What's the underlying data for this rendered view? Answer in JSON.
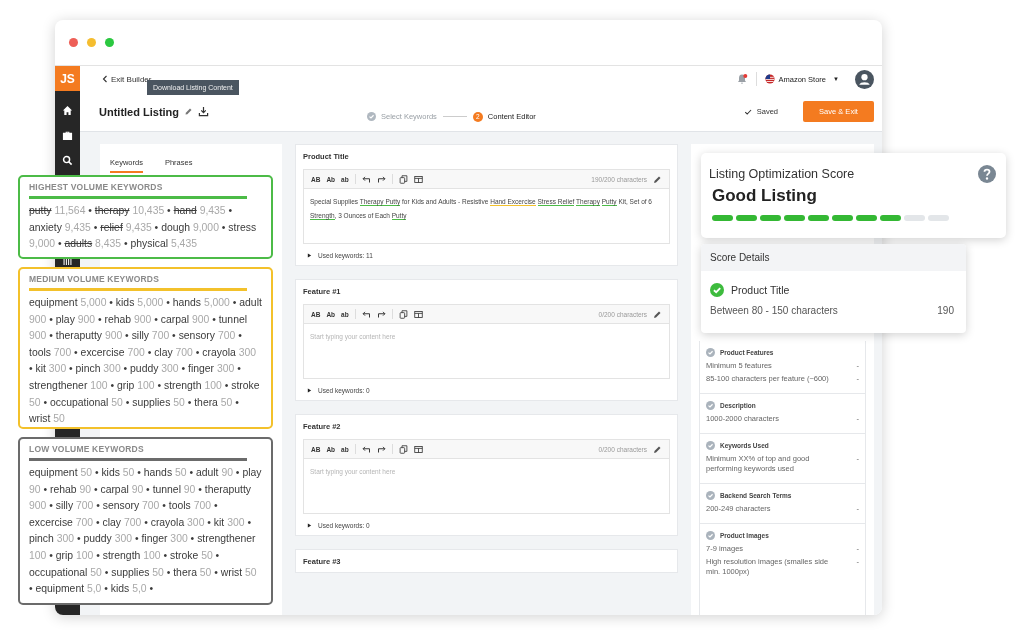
{
  "window": {
    "controls": [
      {
        "color": "#ee5f57"
      },
      {
        "color": "#f5bd2f"
      },
      {
        "color": "#2bc840"
      }
    ]
  },
  "sidebar": {
    "logo": "JS"
  },
  "header": {
    "back_link": "Exit Builder",
    "tooltip": "Download Listing Content",
    "title": "Untitled Listing",
    "steps": [
      {
        "label": "Select Keywords",
        "kind": "done",
        "selected": false
      },
      {
        "label": "Content Editor",
        "number": "2",
        "kind": "current",
        "selected": true
      }
    ],
    "save_status": "Saved",
    "save_button": "Save & Exit",
    "store": "Amazon Store",
    "store_caret": "▼"
  },
  "keyword_tabs": [
    {
      "label": "Keywords",
      "selected": true
    },
    {
      "label": "Phrases",
      "selected": false
    }
  ],
  "separator": "•",
  "keyword_groups": [
    {
      "title": "HIGHEST VOLUME KEYWORDS",
      "color": "#4cbb47",
      "trailing_separator": false,
      "keywords": [
        {
          "word": "putty",
          "count": "11,564",
          "struck": true
        },
        {
          "word": "therapy",
          "count": "10,435",
          "struck": true
        },
        {
          "word": "hand",
          "count": "9,435",
          "struck": true
        },
        {
          "word": "anxiety",
          "count": "9,435",
          "struck": false
        },
        {
          "word": "relief",
          "count": "9,435",
          "struck": true
        },
        {
          "word": "dough",
          "count": "9,000",
          "struck": false
        },
        {
          "word": "stress",
          "count": "9,000",
          "struck": false
        },
        {
          "word": "adults",
          "count": "8,435",
          "struck": true
        },
        {
          "word": "physical",
          "count": "5,435",
          "struck": false
        }
      ]
    },
    {
      "title": "MEDIUM VOLUME KEYWORDS",
      "color": "#f3c12b",
      "trailing_separator": false,
      "keywords": [
        {
          "word": "equipment",
          "count": "5,000",
          "struck": false
        },
        {
          "word": "kids",
          "count": "5,000",
          "struck": false
        },
        {
          "word": "hands",
          "count": "5,000",
          "struck": false
        },
        {
          "word": "adult",
          "count": "900",
          "struck": false
        },
        {
          "word": "play",
          "count": "900",
          "struck": false
        },
        {
          "word": "rehab",
          "count": "900",
          "struck": false
        },
        {
          "word": "carpal",
          "count": "900",
          "struck": false
        },
        {
          "word": "tunnel",
          "count": "900",
          "struck": false
        },
        {
          "word": "theraputty",
          "count": "900",
          "struck": false
        },
        {
          "word": "silly",
          "count": "700",
          "struck": false
        },
        {
          "word": "sensory",
          "count": "700",
          "struck": false
        },
        {
          "word": "tools",
          "count": "700",
          "struck": false
        },
        {
          "word": "excercise",
          "count": "700",
          "struck": false
        },
        {
          "word": "clay",
          "count": "700",
          "struck": false
        },
        {
          "word": "crayola",
          "count": "300",
          "struck": false
        },
        {
          "word": "kit",
          "count": "300",
          "struck": false
        },
        {
          "word": "pinch",
          "count": "300",
          "struck": false
        },
        {
          "word": "puddy",
          "count": "300",
          "struck": false
        },
        {
          "word": "finger",
          "count": "300",
          "struck": false
        },
        {
          "word": "strengthener",
          "count": "100",
          "struck": false
        },
        {
          "word": "grip",
          "count": "100",
          "struck": false
        },
        {
          "word": "strength",
          "count": "100",
          "struck": false
        },
        {
          "word": "stroke",
          "count": "50",
          "struck": false
        },
        {
          "word": "occupational",
          "count": "50",
          "struck": false
        },
        {
          "word": "supplies",
          "count": "50",
          "struck": false
        },
        {
          "word": "thera",
          "count": "50",
          "struck": false
        },
        {
          "word": "wrist",
          "count": "50",
          "struck": false
        }
      ]
    },
    {
      "title": "LOW VOLUME KEYWORDS",
      "color": "#6b6b6b",
      "trailing_separator": true,
      "keywords": [
        {
          "word": "equipment",
          "count": "50",
          "struck": false
        },
        {
          "word": "kids",
          "count": "50",
          "struck": false
        },
        {
          "word": "hands",
          "count": "50",
          "struck": false
        },
        {
          "word": "adult",
          "count": "90",
          "struck": false
        },
        {
          "word": "play",
          "count": "90",
          "struck": false
        },
        {
          "word": "rehab",
          "count": "90",
          "struck": false
        },
        {
          "word": "carpal",
          "count": "90",
          "struck": false
        },
        {
          "word": "tunnel",
          "count": "90",
          "struck": false
        },
        {
          "word": "theraputty",
          "count": "900",
          "struck": false
        },
        {
          "word": "silly",
          "count": "700",
          "struck": false
        },
        {
          "word": "sensory",
          "count": "700",
          "struck": false
        },
        {
          "word": "tools",
          "count": "700",
          "struck": false
        },
        {
          "word": "excercise",
          "count": "700",
          "struck": false
        },
        {
          "word": "clay",
          "count": "700",
          "struck": false
        },
        {
          "word": "crayola",
          "count": "300",
          "struck": false
        },
        {
          "word": "kit",
          "count": "300",
          "struck": false
        },
        {
          "word": "pinch",
          "count": "300",
          "struck": false
        },
        {
          "word": "puddy",
          "count": "300",
          "struck": false
        },
        {
          "word": "finger",
          "count": "300",
          "struck": false
        },
        {
          "word": "strengthener",
          "count": "100",
          "struck": false
        },
        {
          "word": "grip",
          "count": "100",
          "struck": false
        },
        {
          "word": "strength",
          "count": "100",
          "struck": false
        },
        {
          "word": "stroke",
          "count": "50",
          "struck": false
        },
        {
          "word": "occupational",
          "count": "50",
          "struck": false
        },
        {
          "word": "supplies",
          "count": "50",
          "struck": false
        },
        {
          "word": "thera",
          "count": "50",
          "struck": false
        },
        {
          "word": "wrist",
          "count": "50",
          "struck": false
        },
        {
          "word": "equipment",
          "count": "5,0",
          "struck": false
        },
        {
          "word": "kids",
          "count": "5,0",
          "struck": false
        }
      ]
    }
  ],
  "editors": [
    {
      "label": "Product Title",
      "tools": [
        "AB",
        "Ab",
        "ab"
      ],
      "count": "190/200 characters",
      "used_keywords": "Used keywords: 11",
      "segments": [
        {
          "text": "Special Supplies "
        },
        {
          "text": "Therapy Putty",
          "color": "#4cbb47"
        },
        {
          "text": " for Kids and Adults - Resistive "
        },
        {
          "text": "Hand Excercise ",
          "color": "#f3c12b"
        },
        {
          "text": "Stress Relief ",
          "color": "#4cbb47"
        },
        {
          "text": "Therapy ",
          "color": "#4cbb47"
        },
        {
          "text": "Putty",
          "color": "#4cbb47"
        },
        {
          "text": " Kit, Set of 6 "
        },
        {
          "text": "Strength",
          "color": "#4cbb47"
        },
        {
          "text": ", 3 Ounces of Each "
        },
        {
          "text": "Putty",
          "color": "#4cbb47"
        }
      ]
    },
    {
      "label": "Feature #1",
      "tools": [
        "AB",
        "Ab",
        "ab"
      ],
      "count": "0/200 characters",
      "used_keywords": "Used keywords: 0",
      "placeholder": "Start typing your content here"
    },
    {
      "label": "Feature #2",
      "tools": [
        "AB",
        "Ab",
        "ab"
      ],
      "count": "0/200 characters",
      "used_keywords": "Used keywords: 0",
      "placeholder": "Start typing your content here"
    },
    {
      "label": "Feature #3"
    }
  ],
  "score": {
    "title": "Listing Optimization Score",
    "rating": "Good Listing",
    "level": 0.8
  },
  "score_details": {
    "title": "Score Details",
    "items": [
      {
        "title": "Product Title",
        "checked": true,
        "rows": [
          {
            "text": "Between 80 - 150 characters",
            "value": "190"
          }
        ]
      }
    ]
  },
  "requirements": [
    {
      "title": "Product Features",
      "checked": false,
      "rows": [
        {
          "text": "Minimum 5 features",
          "value": "-"
        },
        {
          "text": "85-100 characters per feature (~600)",
          "value": "-"
        }
      ]
    },
    {
      "title": "Description",
      "checked": false,
      "rows": [
        {
          "text": "1000-2000 characters",
          "value": "-"
        }
      ]
    },
    {
      "title": "Keywords Used",
      "checked": false,
      "rows": [
        {
          "text": "Minimum XX% of top and good performing keywords used",
          "value": "-"
        }
      ]
    },
    {
      "title": "Backend Search Terms",
      "checked": false,
      "rows": [
        {
          "text": "200-249 characters",
          "value": "-"
        }
      ]
    },
    {
      "title": "Product Images",
      "checked": false,
      "rows": [
        {
          "text": "7-9 images",
          "value": "-"
        },
        {
          "text": "High resolution images (smalles side min. 1000px)",
          "value": "-"
        }
      ]
    }
  ]
}
